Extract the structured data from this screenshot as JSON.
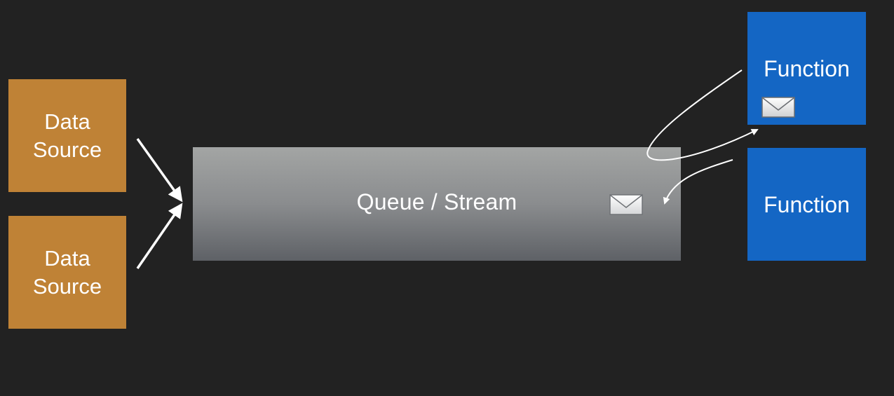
{
  "data_sources": [
    {
      "line1": "Data",
      "line2": "Source"
    },
    {
      "line1": "Data",
      "line2": "Source"
    }
  ],
  "queue": {
    "label": "Queue / Stream",
    "icon": "envelope-icon"
  },
  "functions": [
    {
      "label": "Function",
      "icon": "envelope-icon"
    },
    {
      "label": "Function"
    }
  ],
  "colors": {
    "background": "#222222",
    "data_source": "#bf8236",
    "function": "#1466c4",
    "queue_top": "#a3a5a4",
    "queue_bottom": "#5e6166",
    "arrow": "#ffffff"
  }
}
